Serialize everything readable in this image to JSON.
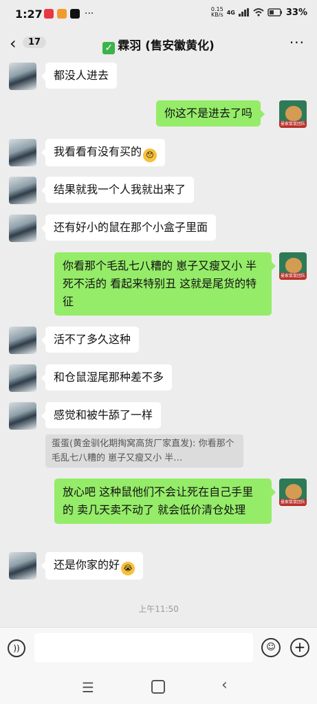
{
  "status": {
    "time": "1:27",
    "speed_top": "0.15",
    "speed_unit": "KB/s",
    "network": "4G",
    "battery": "33%"
  },
  "header": {
    "back_count": "17",
    "title": "霖羽 (售安徽黄化)"
  },
  "messages": [
    {
      "text": "都没人进去"
    },
    {
      "text": "你这不是进去了吗"
    },
    {
      "text": "我看看有没有买的"
    },
    {
      "text": "结果就我一个人我就出来了"
    },
    {
      "text": "还有好小的鼠在那个小盒子里面"
    },
    {
      "text": "你看那个毛乱七八糟的  崽子又瘦又小  半死不活的  看起来特别丑  这就是尾货的特征"
    },
    {
      "text": "活不了多久这种"
    },
    {
      "text": "和仓鼠湿尾那种差不多"
    },
    {
      "text": "感觉和被牛舔了一样"
    },
    {
      "text": "放心吧 这种鼠他们不会让死在自己手里的  卖几天卖不动了 就会低价清仓处理"
    },
    {
      "text": "还是你家的好"
    }
  ],
  "quote": {
    "text": "蛋蛋(黄金驯化期掏窝高货厂家直发): 你看那个毛乱七八糟的  崽子又瘦又小  半…"
  },
  "timestamp": "上午11:50",
  "self_avatar_label": "曼家鼠鼠团队",
  "colors": {
    "outgoing_bubble": "#95ec69",
    "incoming_bubble": "#ffffff",
    "background": "#ededed"
  },
  "icons": {
    "back": "chevron-left-icon",
    "more": "more-icon",
    "voice": "voice-icon",
    "emoji": "emoji-icon",
    "plus": "plus-icon"
  }
}
